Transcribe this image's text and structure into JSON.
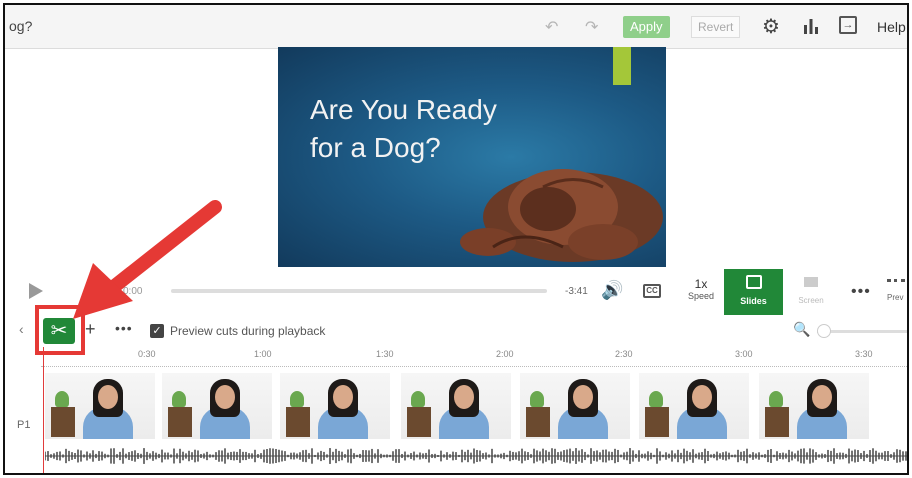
{
  "topbar": {
    "title": "og?",
    "undo_icon": "undo-icon",
    "redo_icon": "redo-icon",
    "apply_label": "Apply",
    "revert_label": "Revert",
    "settings_icon": "gear-icon",
    "stats_icon": "bar-chart-icon",
    "exit_icon": "exit-icon",
    "help_label": "Help"
  },
  "slide": {
    "title_line1": "Are You Ready",
    "title_line2": "for a Dog?"
  },
  "player": {
    "current_time": "0:00",
    "remaining_time": "-3:41",
    "progress_fraction": 0.0,
    "speed_value": "1x",
    "speed_label": "Speed",
    "slides_label": "Slides",
    "screen_label": "Screen",
    "preview_label": "Prev"
  },
  "edit": {
    "add_label": "+",
    "more_label": "•••",
    "preview_cuts_checked": true,
    "preview_cuts_label": "Preview cuts during playback"
  },
  "timeline": {
    "ticks": [
      "0:30",
      "1:00",
      "1:30",
      "2:00",
      "2:30",
      "3:00",
      "3:30"
    ],
    "track_label": "P1",
    "thumbnail_count": 7
  },
  "annotation": {
    "highlight_color": "#e53935",
    "target": "scissors-cut-button"
  },
  "colors": {
    "accent_green": "#218838",
    "apply_green": "#8fcf8a",
    "slide_accent": "#a4c739"
  }
}
